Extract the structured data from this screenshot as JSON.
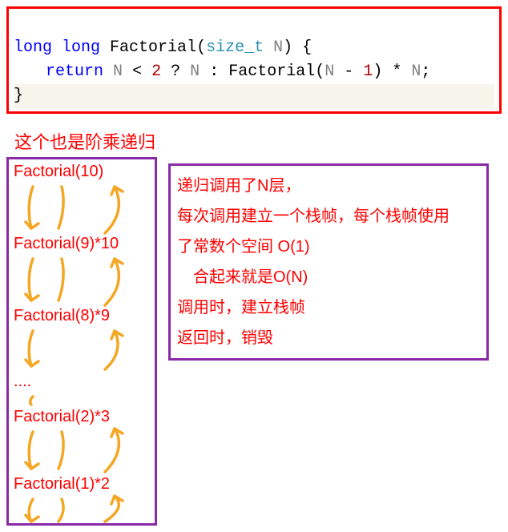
{
  "code": {
    "line1": {
      "type": "long long",
      "space": " ",
      "fn": "Factorial",
      "open_paren": "(",
      "param_type": "size_t",
      "param_space": " ",
      "param_name": "N",
      "close_paren": ")",
      "brace": " {"
    },
    "line2": {
      "ret": "return",
      "s1": " ",
      "n1": "N",
      "s2": " ",
      "lt": "<",
      "s3": " ",
      "two": "2",
      "s4": " ",
      "q": "?",
      "s5": " ",
      "n2": "N",
      "s6": " ",
      "colon": ":",
      "s7": " ",
      "fn": "Factorial",
      "open": "(",
      "n3": "N",
      "s8": " ",
      "minus": "-",
      "s9": " ",
      "one": "1",
      "close": ")",
      "s10": " ",
      "star": "*",
      "s11": " ",
      "n4": "N",
      "semi": ";"
    },
    "line3": "}"
  },
  "caption": "这个也是阶乘递归",
  "recursion": {
    "steps": [
      "Factorial(10)",
      "Factorial(9)*10",
      "Factorial(8)*9",
      "....",
      "Factorial(2)*3",
      "Factorial(1)*2"
    ]
  },
  "explain": {
    "l1": "递归调用了N层，",
    "l2": "每次调用建立一个栈帧，每个栈帧使用",
    "l3": "了常数个空间 O(1)",
    "l4": "　合起来就是O(N)",
    "l5": "调用时，建立栈帧",
    "l6": "返回时，销毁"
  }
}
